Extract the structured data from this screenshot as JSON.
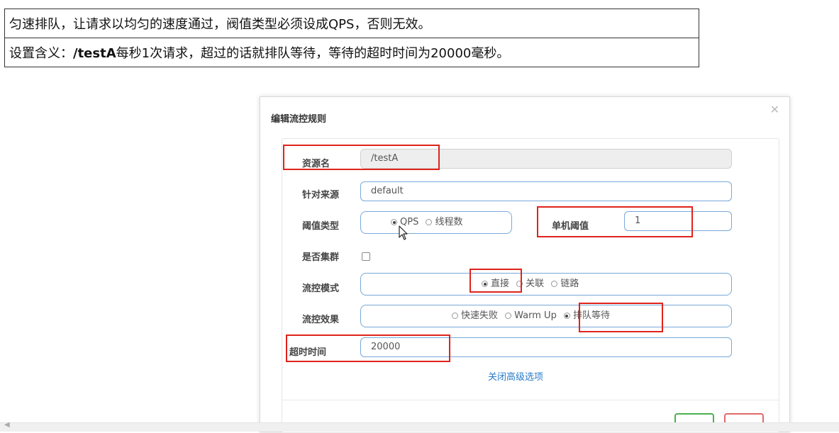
{
  "notes": {
    "line1": "匀速排队，让请求以均匀的速度通过，阀值类型必须设成QPS，否则无效。",
    "line2_prefix": "设置含义：",
    "line2_resource": "/testA",
    "line2_suffix": "每秒1次请求，超过的话就排队等待，等待的超时时间为20000毫秒。"
  },
  "dialog": {
    "title": "编辑流控规则",
    "close_icon": "close-icon",
    "resource_label": "资源名",
    "resource_value": "/testA",
    "source_label": "针对来源",
    "source_value": "default",
    "threshold_type_label": "阈值类型",
    "threshold_type_options": [
      "QPS",
      "线程数"
    ],
    "threshold_type_selected": "QPS",
    "single_threshold_label": "单机阈值",
    "single_threshold_value": "1",
    "cluster_label": "是否集群",
    "cluster_checked": false,
    "flow_mode_label": "流控模式",
    "flow_mode_options": [
      "直接",
      "关联",
      "链路"
    ],
    "flow_mode_selected": "直接",
    "flow_effect_label": "流控效果",
    "flow_effect_options": [
      "快速失败",
      "Warm Up",
      "排队等待"
    ],
    "flow_effect_selected": "排队等待",
    "timeout_label": "超时时间",
    "timeout_value": "20000",
    "advanced_link": "关闭高级选项"
  },
  "colors": {
    "highlight": "#e0231b",
    "field_border": "#79a8d9",
    "link": "#2a7cc7",
    "save": "#4caf50",
    "cancel": "#e06a6a"
  }
}
